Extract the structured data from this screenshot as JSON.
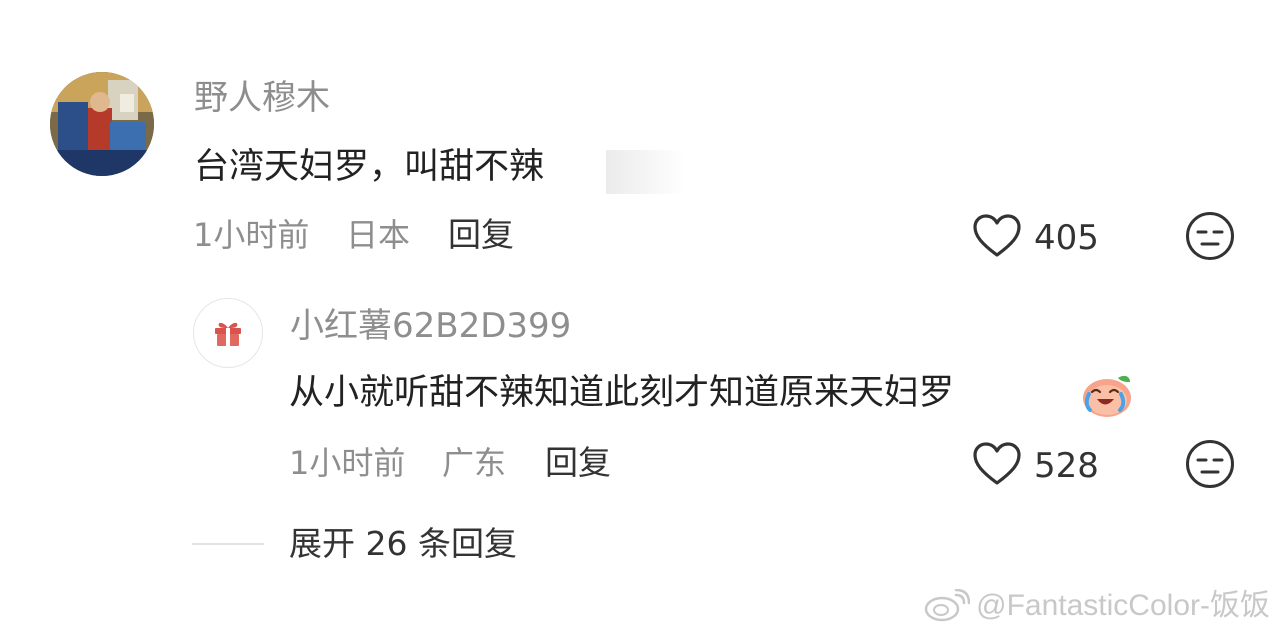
{
  "comment": {
    "username": "野人穆木",
    "text": "台湾天妇罗，叫甜不辣",
    "time": "1小时前",
    "location": "日本",
    "reply_label": "回复",
    "likes": "405",
    "avatar_icon": "user-avatar-painting"
  },
  "reply": {
    "username": "小红薯62B2D399",
    "text": "从小就听甜不辣知道此刻才知道原来天妇罗",
    "emoji_icon": "crying-laughing-peach-emoji-icon",
    "time": "1小时前",
    "location": "广东",
    "reply_label": "回复",
    "likes": "528",
    "avatar_icon": "gift-icon"
  },
  "expand_label": "展开 26 条回复",
  "watermark": "@FantasticColor-饭饭",
  "colors": {
    "muted_text": "#8e8e8e",
    "main_text": "#222222",
    "gift_red": "#d9534f"
  }
}
